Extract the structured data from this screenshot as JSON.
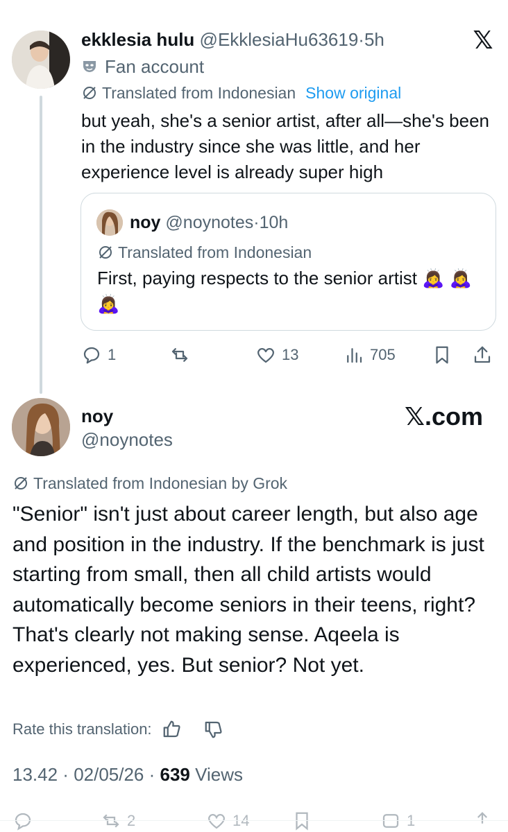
{
  "tweet1": {
    "author_name": "ekklesia hulu",
    "author_handle": "@EkklesiaHu63619",
    "separator": "·",
    "time": "5h",
    "label": "Fan account",
    "translated_text": "Translated from Indonesian",
    "show_original": "Show original",
    "body": "but yeah, she's a senior artist, after all—she's been in the industry since she was little, and her experience level is already super high",
    "quote": {
      "author_name": "noy",
      "author_handle": "@noynotes",
      "separator": "·",
      "time": "10h",
      "translated_text": "Translated from Indonesian",
      "body": "First, paying respects to the senior artist 🙇‍♀️ 🙇‍♀️ 🙇‍♀️"
    },
    "actions": {
      "replies": "1",
      "reposts": "",
      "likes": "13",
      "views": "705"
    }
  },
  "tweet2": {
    "author_name": "noy",
    "author_handle": "@noynotes",
    "watermark": "𝕏.com",
    "translated_text": "Translated from Indonesian by Grok",
    "body": "\"Senior\" isn't just about career length, but also age and position in the industry. If the benchmark is just starting from small, then all child artists would automatically become seniors in their teens, right? That's clearly not making sense. Aqeela is experienced, yes. But senior? Not yet.",
    "rate_label": "Rate this translation:",
    "time": "13.42",
    "date": "02/05/26",
    "views_count": "639",
    "views_label": "Views",
    "actions": {
      "reposts": "2",
      "likes": "14",
      "bookmarks": "1"
    }
  },
  "brand": {
    "logo": "𝕏"
  },
  "colors": {
    "text": "#0f1419",
    "muted": "#536471",
    "link": "#1d9bf0",
    "border": "#cfd9de"
  }
}
